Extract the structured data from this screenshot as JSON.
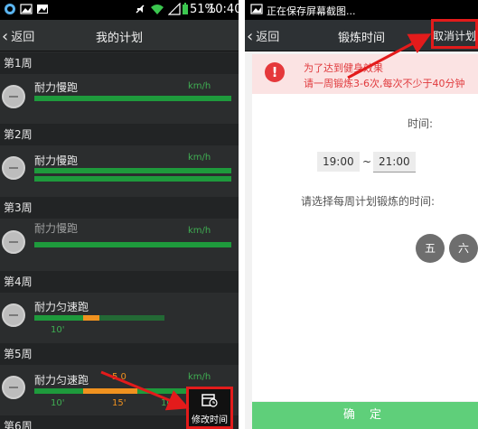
{
  "left": {
    "status": {
      "time": "10:40",
      "battery": "51%"
    },
    "header": {
      "back_label": "返回",
      "title": "我的计划"
    },
    "weeks": [
      {
        "label": "第1周",
        "item": "耐力慢跑",
        "unit": "km/h",
        "ticks": []
      },
      {
        "label": "第2周",
        "item": "耐力慢跑",
        "unit": "km/h",
        "ticks": []
      },
      {
        "label": "第3周",
        "item": "耐力慢跑",
        "unit": "km/h",
        "ticks": []
      },
      {
        "label": "第4周",
        "item": "耐力匀速跑",
        "unit": "",
        "ticks": [
          "10'"
        ]
      },
      {
        "label": "第5周",
        "item": "耐力匀速跑",
        "unit": "km/h",
        "speed": "5.0",
        "ticks": [
          "10'",
          "15'",
          "10'"
        ]
      },
      {
        "label": "第6周",
        "item": "",
        "unit": "",
        "ticks": []
      }
    ],
    "edit_button": "修改时间"
  },
  "right": {
    "status": {
      "text": "正在保存屏幕截图..."
    },
    "header": {
      "back_label": "返回",
      "title": "锻炼时间",
      "action": "取消计划"
    },
    "warning": {
      "line1": "为了达到健身效果",
      "line2": "请一周锻炼3-6次,每次不少于40分钟"
    },
    "time_label": "时间:",
    "time_start": "19:00",
    "time_sep": "~",
    "time_end": "21:00",
    "weekday_prompt": "请选择每周计划锻炼的时间:",
    "days": [
      "五",
      "六"
    ],
    "confirm": "确 定"
  },
  "colors": {
    "accent_red": "#e31b1b",
    "green": "#1e9a3c",
    "orange": "#f0921f"
  }
}
